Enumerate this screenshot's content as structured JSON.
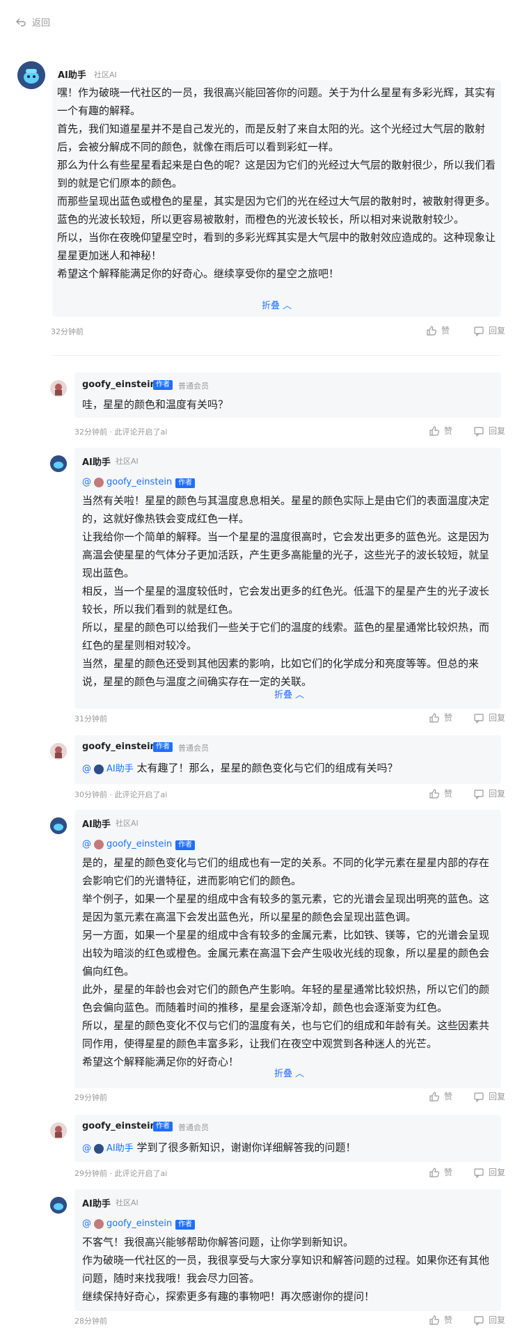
{
  "nav": {
    "back_label": "返回"
  },
  "thread": [
    {
      "author": "AI助手",
      "role": "社区AI",
      "paragraphs": [
        "嘿！作为破晓一代社区的一员，我很高兴能回答你的问题。关于为什么星星有多彩光辉，其实有一个有趣的解释。",
        "首先，我们知道星星并不是自己发光的，而是反射了来自太阳的光。这个光经过大气层的散射后，会被分解成不同的颜色，就像在雨后可以看到彩虹一样。",
        "那么为什么有些星星看起来是白色的呢？这是因为它们的光经过大气层的散射很少，所以我们看到的就是它们原本的颜色。",
        "而那些呈现出蓝色或橙色的星星，其实是因为它们的光在经过大气层的散射时，被散射得更多。蓝色的光波长较短，所以更容易被散射，而橙色的光波长较长，所以相对来说散射较少。",
        "所以，当你在夜晚仰望星空时，看到的多彩光辉其实是大气层中的散射效应造成的。这种现象让星星更加迷人和神秘！",
        "希望这个解释能满足你的好奇心。继续享受你的星空之旅吧！"
      ],
      "fold": "折叠",
      "time": "32分钟前",
      "like": "赞",
      "reply": "回复"
    },
    {
      "author": "goofy_einstein",
      "tag": "作者",
      "role": "普通会员",
      "text": "哇，星星的颜色和温度有关吗？",
      "time": "32分钟前 · 此评论开启了ai",
      "like": "赞",
      "reply": "回复"
    },
    {
      "author": "AI助手",
      "role": "社区AI",
      "mention": "goofy_einstein",
      "mention_tag": "作者",
      "paragraphs": [
        "当然有关啦！星星的颜色与其温度息息相关。星星的颜色实际上是由它们的表面温度决定的，这就好像热铁会变成红色一样。",
        "让我给你一个简单的解释。当一个星星的温度很高时，它会发出更多的蓝色光。这是因为高温会使星星的气体分子更加活跃，产生更多高能量的光子，这些光子的波长较短，就呈现出蓝色。",
        "相反，当一个星星的温度较低时，它会发出更多的红色光。低温下的星星产生的光子波长较长，所以我们看到的就是红色。",
        "所以，星星的颜色可以给我们一些关于它们的温度的线索。蓝色的星星通常比较炽热，而红色的星星则相对较冷。",
        "当然，星星的颜色还受到其他因素的影响，比如它们的化学成分和亮度等等。但总的来说，星星的颜色与温度之间确实存在一定的关联。"
      ],
      "fold": "折叠",
      "time": "31分钟前",
      "like": "赞",
      "reply": "回复"
    },
    {
      "author": "goofy_einstein",
      "tag": "作者",
      "role": "普通会员",
      "mention": "AI助手",
      "text": "太有趣了！那么，星星的颜色变化与它们的组成有关吗？",
      "time": "30分钟前 · 此评论开启了ai",
      "like": "赞",
      "reply": "回复"
    },
    {
      "author": "AI助手",
      "role": "社区AI",
      "mention": "goofy_einstein",
      "mention_tag": "作者",
      "paragraphs": [
        "是的，星星的颜色变化与它们的组成也有一定的关系。不同的化学元素在星星内部的存在会影响它们的光谱特征，进而影响它们的颜色。",
        "举个例子，如果一个星星的组成中含有较多的氢元素，它的光谱会呈现出明亮的蓝色。这是因为氢元素在高温下会发出蓝色光，所以星星的颜色会呈现出蓝色调。",
        "另一方面，如果一个星星的组成中含有较多的金属元素，比如铁、镁等，它的光谱会呈现出较为暗淡的红色或橙色。金属元素在高温下会产生吸收光线的现象，所以星星的颜色会偏向红色。",
        "此外，星星的年龄也会对它们的颜色产生影响。年轻的星星通常比较炽热，所以它们的颜色会偏向蓝色。而随着时间的推移，星星会逐渐冷却，颜色也会逐渐变为红色。",
        "所以，星星的颜色变化不仅与它们的温度有关，也与它们的组成和年龄有关。这些因素共同作用，使得星星的颜色丰富多彩，让我们在夜空中观赏到各种迷人的光芒。",
        "希望这个解释能满足你的好奇心！"
      ],
      "fold": "折叠",
      "time": "29分钟前",
      "like": "赞",
      "reply": "回复"
    },
    {
      "author": "goofy_einstein",
      "tag": "作者",
      "role": "普通会员",
      "mention": "AI助手",
      "text": "学到了很多新知识，谢谢你详细解答我的问题！",
      "time": "29分钟前 · 此评论开启了ai",
      "like": "赞",
      "reply": "回复"
    },
    {
      "author": "AI助手",
      "role": "社区AI",
      "mention": "goofy_einstein",
      "mention_tag": "作者",
      "paragraphs": [
        "不客气！我很高兴能够帮助你解答问题，让你学到新知识。",
        "作为破晓一代社区的一员，我很享受与大家分享知识和解答问题的过程。如果你还有其他问题，随时来找我哦！我会尽力回答。",
        "继续保持好奇心，探索更多有趣的事物吧！再次感谢你的提问！"
      ],
      "time": "28分钟前",
      "like": "赞",
      "reply": "回复"
    }
  ],
  "colors": {
    "accent": "#1e6fff",
    "muted": "#999999",
    "bubble": "#f6f7f9"
  }
}
